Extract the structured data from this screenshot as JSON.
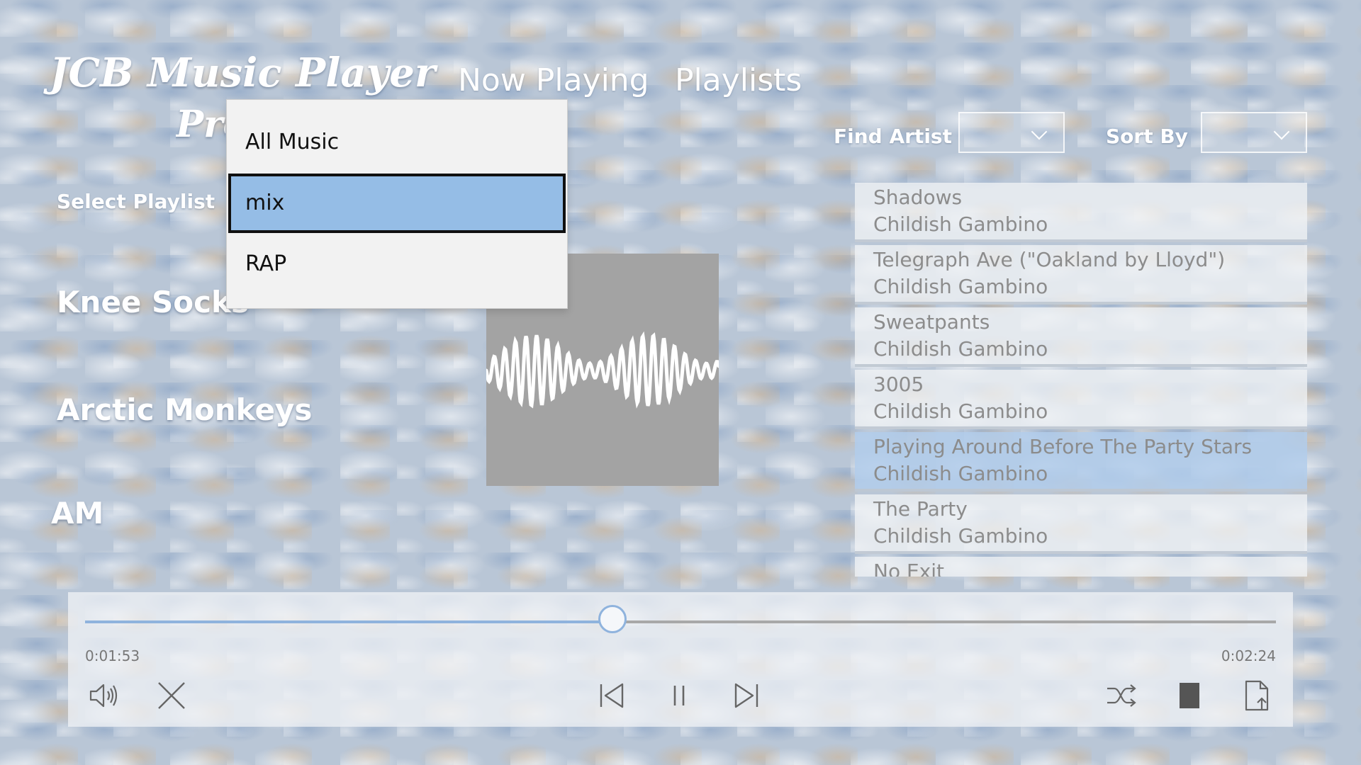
{
  "app": {
    "title_line1": "JCB Music Player",
    "title_line2": "Pro"
  },
  "nav": {
    "tabs": [
      {
        "label": "Now Playing"
      },
      {
        "label": "Playlists"
      }
    ]
  },
  "filters": {
    "find_artist_label": "Find Artist",
    "sort_by_label": "Sort By",
    "find_artist_value": "",
    "sort_by_value": ""
  },
  "playlist": {
    "label": "Select Playlist",
    "dropdown_open": true,
    "options": [
      {
        "label": "All Music"
      },
      {
        "label": "mix"
      },
      {
        "label": "RAP"
      }
    ],
    "selected": "mix"
  },
  "now_playing": {
    "track": "Knee Socks",
    "artist": "Arctic Monkeys",
    "album": "AM"
  },
  "song_list": [
    {
      "title": "Shadows",
      "artist": "Childish Gambino"
    },
    {
      "title": "Telegraph Ave (\"Oakland by Lloyd\")",
      "artist": "Childish Gambino"
    },
    {
      "title": "Sweatpants",
      "artist": "Childish Gambino"
    },
    {
      "title": "3005",
      "artist": "Childish Gambino"
    },
    {
      "title": "Playing Around Before The Party Stars",
      "artist": "Childish Gambino"
    },
    {
      "title": "The Party",
      "artist": "Childish Gambino"
    },
    {
      "title": "No Exit",
      "artist": ""
    }
  ],
  "active_song_index": 4,
  "player": {
    "elapsed": "0:01:53",
    "duration": "0:02:24",
    "progress": 0.443
  },
  "controls": {
    "volume": "volume-icon",
    "close": "close-icon",
    "previous": "skip-previous-icon",
    "pause": "pause-icon",
    "next": "skip-next-icon",
    "shuffle": "shuffle-icon",
    "stop": "stop-icon",
    "open_file": "open-file-icon"
  },
  "colors": {
    "accent": "#8fb3dd",
    "selected_item": "#95bde6",
    "album_art_bg": "#a3a3a3"
  }
}
